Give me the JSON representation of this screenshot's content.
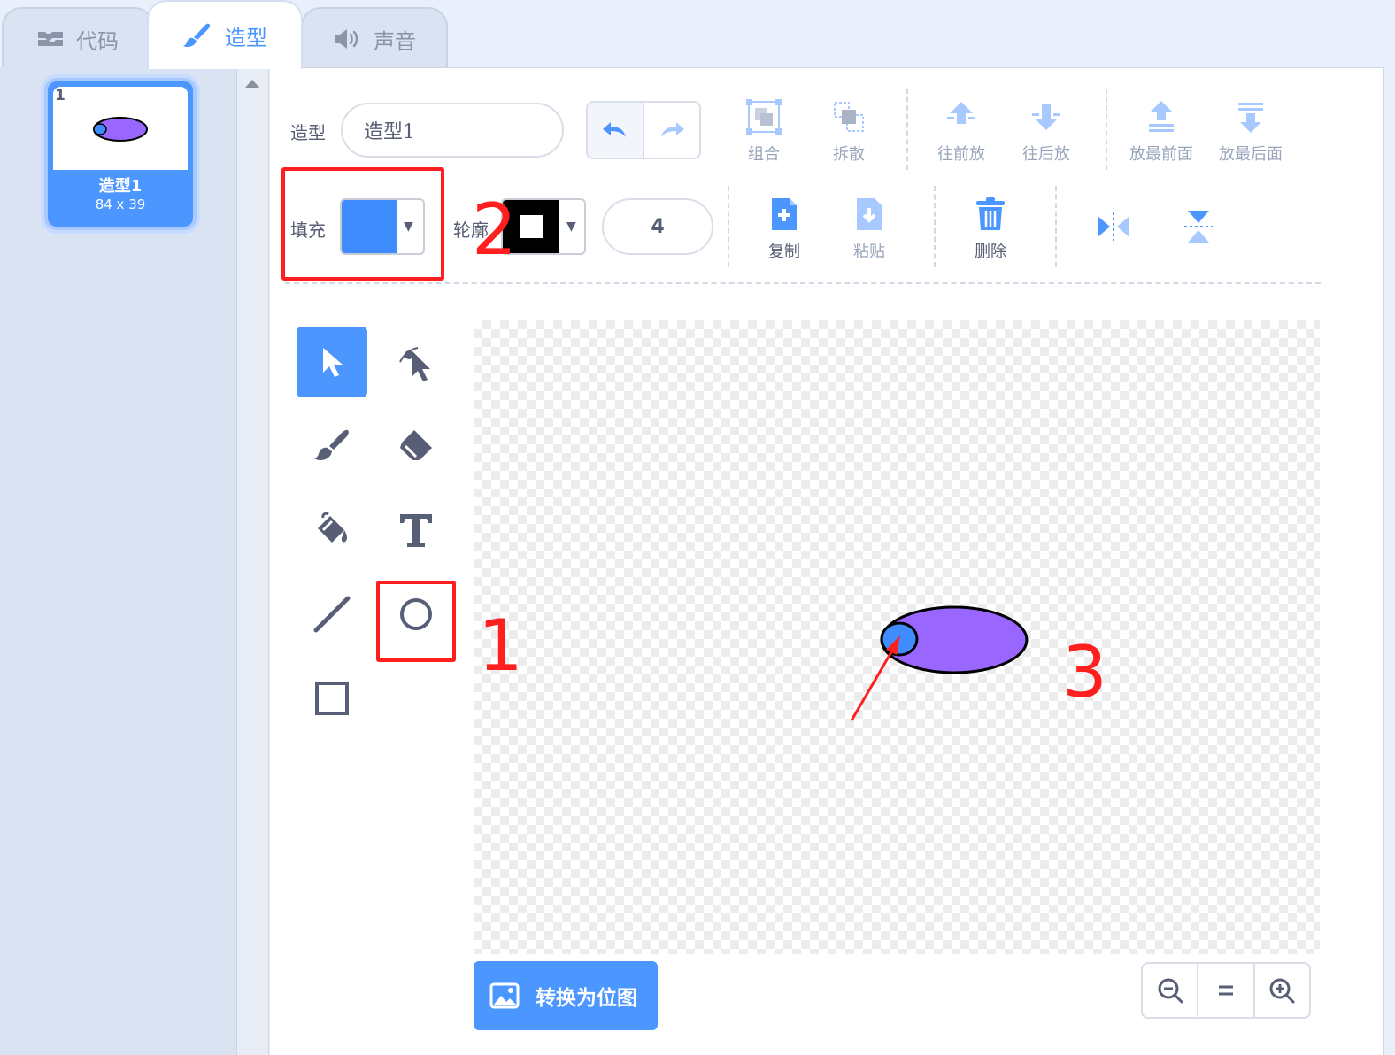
{
  "tabs": {
    "code": "代码",
    "costume": "造型",
    "sound": "声音"
  },
  "costume_list": {
    "items": [
      {
        "number": "1",
        "name": "造型1",
        "size": "84 x 39"
      }
    ]
  },
  "toolbar": {
    "costume_label": "造型",
    "costume_name": "造型1",
    "group": "组合",
    "ungroup": "拆散",
    "forward": "往前放",
    "backward": "往后放",
    "front": "放最前面",
    "back": "放最后面",
    "fill_label": "填充",
    "outline_label": "轮廓",
    "outline_width": "4",
    "copy": "复制",
    "paste": "粘贴",
    "delete": "删除"
  },
  "colors": {
    "fill": "#3f8cff",
    "outline": "#000000",
    "ellipse_fill": "#9966ff",
    "accent": "#4c97ff",
    "annotation": "#ff1f1f"
  },
  "tools": [
    "select-icon",
    "reshape-icon",
    "brush-icon",
    "eraser-icon",
    "fill-icon",
    "text-icon",
    "line-icon",
    "circle-icon",
    "rectangle-icon"
  ],
  "annotations": {
    "one": "1",
    "two": "2",
    "three": "3"
  },
  "bottom": {
    "convert_bitmap": "转换为位图"
  }
}
